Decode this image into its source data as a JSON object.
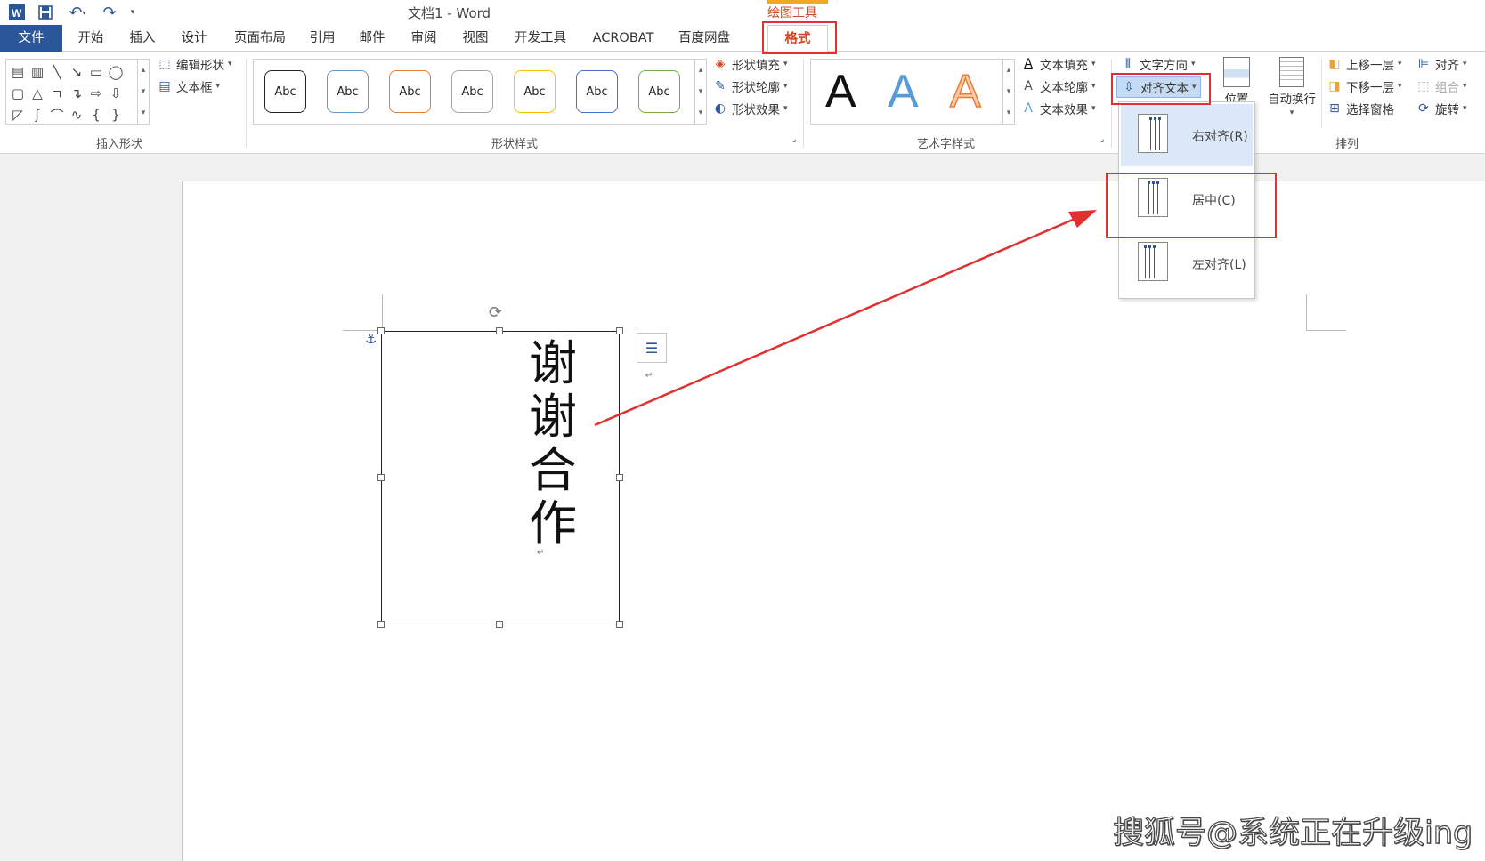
{
  "app": {
    "doc_title": "文档1 - Word",
    "contextual_tool": "绘图工具"
  },
  "tabs": [
    "文件",
    "开始",
    "插入",
    "设计",
    "页面布局",
    "引用",
    "邮件",
    "审阅",
    "视图",
    "开发工具",
    "ACROBAT",
    "百度网盘",
    "格式"
  ],
  "ribbon": {
    "insert_shapes": {
      "edit_shape": "编辑形状",
      "text_box": "文本框",
      "label": "插入形状"
    },
    "shape_styles": {
      "sample_label": "Abc",
      "fill": "形状填充",
      "outline": "形状轮廓",
      "effects": "形状效果",
      "label": "形状样式"
    },
    "wordart": {
      "letter": "A",
      "text_fill": "文本填充",
      "text_outline": "文本轮廓",
      "text_effects": "文本效果",
      "label": "艺术字样式"
    },
    "text": {
      "direction": "文字方向",
      "align": "对齐文本",
      "position": "位置",
      "wrap": "自动换行"
    },
    "arrange": {
      "bring_forward": "上移一层",
      "send_backward": "下移一层",
      "selection_pane": "选择窗格",
      "align": "对齐",
      "group": "组合",
      "rotate": "旋转",
      "label": "排列"
    }
  },
  "align_dropdown": {
    "items": [
      "右对齐(R)",
      "居中(C)",
      "左对齐(L)"
    ],
    "selected_index": 0
  },
  "textbox": {
    "text": "谢谢合作"
  },
  "watermark": "搜狐号@系统正在升级ing",
  "colors": {
    "accent": "#2b579a",
    "tool": "#d24726",
    "highlight": "#e03030"
  }
}
